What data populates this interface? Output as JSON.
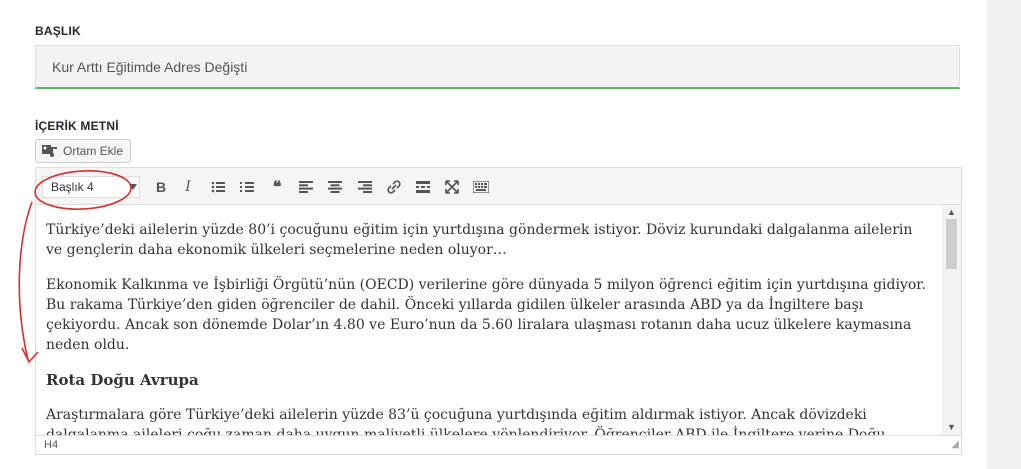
{
  "form": {
    "title_label": "BAŞLIK",
    "title_value": "Kur Arttı Eğitimde Adres Değişti",
    "content_label": "İÇERİK METNİ"
  },
  "media_button": {
    "label": "Ortam Ekle",
    "icon": "media-icon"
  },
  "toolbar": {
    "format_value": "Başlık 4",
    "buttons": [
      "B",
      "I",
      "•≡",
      "1≡",
      "❝",
      "≡",
      "≡",
      "≡",
      "🔗",
      "▬",
      "✕",
      "⌨"
    ]
  },
  "content": {
    "p1": "Türkiye’deki ailelerin yüzde 80’i çocuğunu eğitim için yurtdışına göndermek istiyor. Döviz kurundaki dalgalanma ailelerin ve gençlerin daha ekonomik ülkeleri seçmelerine neden oluyor…",
    "p2": "Ekonomik Kalkınma ve İşbirliği Örgütü’nün (OECD) verilerine göre dünyada 5 milyon öğrenci eğitim için yurtdışına gidiyor. Bu rakama Türkiye’den giden öğrenciler de dahil. Önceki yıllarda gidilen ülkeler arasında ABD ya da İngiltere başı çekiyordu. Ancak son dönemde Dolar’ın 4.80 ve Euro’nun da 5.60 liralara ulaşması rotanın daha ucuz ülkelere kaymasına neden oldu.",
    "h4": "Rota Doğu Avrupa",
    "p3": "Araştırmalara göre Türkiye’deki ailelerin yüzde 83’ü çocuğuna yurtdışında eğitim aldırmak istiyor. Ancak dövizdeki dalgalanma aileleri çoğu zaman daha uygun maliyetli ülkelere yönlendiriyor. Öğrenciler ABD ile İngiltere yerine Doğu Avrupa ülkelerini tercih ediyor."
  },
  "status": {
    "path": "H4"
  },
  "colors": {
    "accent_green": "#5cb85c",
    "annotation_red": "#d9302c"
  }
}
